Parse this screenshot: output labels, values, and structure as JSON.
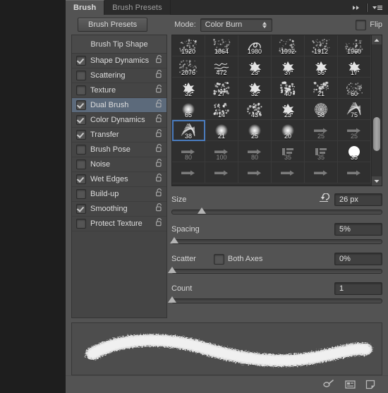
{
  "window": {
    "tabs": [
      {
        "label": "Brush",
        "active": true
      },
      {
        "label": "Brush Presets",
        "active": false
      }
    ],
    "collapse_icon": "double-chevron-right-icon",
    "menu_icon": "panel-menu-icon"
  },
  "toolbar": {
    "brush_presets_button": "Brush Presets",
    "mode_label": "Mode:",
    "mode_value": "Color Burn",
    "flip_label": "Flip",
    "flip_checked": false
  },
  "options": {
    "header": "Brush Tip Shape",
    "items": [
      {
        "label": "Shape Dynamics",
        "checked": true,
        "selected": false,
        "lock": "unlocked-icon"
      },
      {
        "label": "Scattering",
        "checked": false,
        "selected": false,
        "lock": "unlocked-icon"
      },
      {
        "label": "Texture",
        "checked": false,
        "selected": false,
        "lock": "unlocked-icon"
      },
      {
        "label": "Dual Brush",
        "checked": true,
        "selected": true,
        "lock": "unlocked-icon"
      },
      {
        "label": "Color Dynamics",
        "checked": true,
        "selected": false,
        "lock": "unlocked-icon"
      },
      {
        "label": "Transfer",
        "checked": true,
        "selected": false,
        "lock": "unlocked-icon"
      },
      {
        "label": "Brush Pose",
        "checked": false,
        "selected": false,
        "lock": "unlocked-icon"
      },
      {
        "label": "Noise",
        "checked": false,
        "selected": false,
        "lock": "unlocked-icon"
      },
      {
        "label": "Wet Edges",
        "checked": true,
        "selected": false,
        "lock": "unlocked-icon"
      },
      {
        "label": "Build-up",
        "checked": false,
        "selected": false,
        "lock": "unlocked-icon"
      },
      {
        "label": "Smoothing",
        "checked": true,
        "selected": false,
        "lock": "unlocked-icon"
      },
      {
        "label": "Protect Texture",
        "checked": false,
        "selected": false,
        "lock": "unlocked-icon"
      }
    ]
  },
  "brush_grid": {
    "selected_size": "38",
    "cells": [
      {
        "size": "1920",
        "shape": "scatter",
        "dim": false,
        "selected": false
      },
      {
        "size": "1864",
        "shape": "scatter",
        "dim": false,
        "selected": false
      },
      {
        "size": "1980",
        "shape": "swirl",
        "dim": false,
        "selected": false
      },
      {
        "size": "1992",
        "shape": "scatter",
        "dim": false,
        "selected": false
      },
      {
        "size": "1912",
        "shape": "scatter",
        "dim": false,
        "selected": false
      },
      {
        "size": "1960",
        "shape": "scatter",
        "dim": false,
        "selected": false
      },
      {
        "size": "2076",
        "shape": "scatter",
        "dim": false,
        "selected": false
      },
      {
        "size": "472",
        "shape": "script",
        "dim": false,
        "selected": false
      },
      {
        "size": "23",
        "shape": "leaf",
        "dim": false,
        "selected": false
      },
      {
        "size": "37",
        "shape": "leaf",
        "dim": false,
        "selected": false
      },
      {
        "size": "56",
        "shape": "leaf",
        "dim": false,
        "selected": false
      },
      {
        "size": "17",
        "shape": "leaf",
        "dim": false,
        "selected": false
      },
      {
        "size": "32",
        "shape": "leaf",
        "dim": false,
        "selected": false
      },
      {
        "size": "27",
        "shape": "spatter",
        "dim": false,
        "selected": false
      },
      {
        "size": "32",
        "shape": "leaf",
        "dim": false,
        "selected": false
      },
      {
        "size": "40",
        "shape": "spatter",
        "dim": false,
        "selected": false
      },
      {
        "size": "21",
        "shape": "spatter",
        "dim": false,
        "selected": false
      },
      {
        "size": "60",
        "shape": "texture",
        "dim": false,
        "selected": false
      },
      {
        "size": "65",
        "shape": "soft",
        "dim": false,
        "selected": false
      },
      {
        "size": "14",
        "shape": "spatter",
        "dim": false,
        "selected": false
      },
      {
        "size": "43",
        "shape": "spatter",
        "dim": false,
        "selected": false
      },
      {
        "size": "23",
        "shape": "leaf",
        "dim": false,
        "selected": false
      },
      {
        "size": "58",
        "shape": "rosette",
        "dim": false,
        "selected": false
      },
      {
        "size": "75",
        "shape": "hatch",
        "dim": false,
        "selected": false
      },
      {
        "size": "38",
        "shape": "hatch",
        "dim": false,
        "selected": true
      },
      {
        "size": "21",
        "shape": "soft",
        "dim": false,
        "selected": false
      },
      {
        "size": "25",
        "shape": "soft",
        "dim": false,
        "selected": false
      },
      {
        "size": "20",
        "shape": "soft",
        "dim": false,
        "selected": false
      },
      {
        "size": "25",
        "shape": "arrow",
        "dim": true,
        "selected": false
      },
      {
        "size": "25",
        "shape": "arrow",
        "dim": true,
        "selected": false
      },
      {
        "size": "80",
        "shape": "arrow",
        "dim": true,
        "selected": false
      },
      {
        "size": "100",
        "shape": "arrow",
        "dim": true,
        "selected": false
      },
      {
        "size": "80",
        "shape": "arrow",
        "dim": true,
        "selected": false
      },
      {
        "size": "35",
        "shape": "flag",
        "dim": true,
        "selected": false
      },
      {
        "size": "35",
        "shape": "flag",
        "dim": true,
        "selected": false
      },
      {
        "size": "35",
        "shape": "hard",
        "dim": false,
        "selected": false
      },
      {
        "size": "",
        "shape": "arrow",
        "dim": true,
        "selected": false
      },
      {
        "size": "",
        "shape": "arrow",
        "dim": true,
        "selected": false
      },
      {
        "size": "",
        "shape": "arrow",
        "dim": true,
        "selected": false
      },
      {
        "size": "",
        "shape": "arrow",
        "dim": true,
        "selected": false
      },
      {
        "size": "",
        "shape": "arrow",
        "dim": true,
        "selected": false
      },
      {
        "size": "",
        "shape": "arrow",
        "dim": true,
        "selected": false
      }
    ]
  },
  "sliders": {
    "size": {
      "label": "Size",
      "value": "26 px",
      "knob_pct": 14,
      "reset_icon": "reset-arrow-icon"
    },
    "spacing": {
      "label": "Spacing",
      "value": "5%",
      "knob_pct": 1
    },
    "scatter": {
      "label": "Scatter",
      "value": "0%",
      "knob_pct": 0,
      "both_axes_label": "Both Axes",
      "both_axes_checked": false
    },
    "count": {
      "label": "Count",
      "value": "1",
      "knob_pct": 0
    }
  },
  "preview": {
    "name": "brush-stroke-preview"
  },
  "footer": {
    "icons": [
      {
        "name": "toggle-live-tip-brush-icon"
      },
      {
        "name": "create-new-brush-preset-icon"
      },
      {
        "name": "new-brush-icon"
      }
    ]
  }
}
